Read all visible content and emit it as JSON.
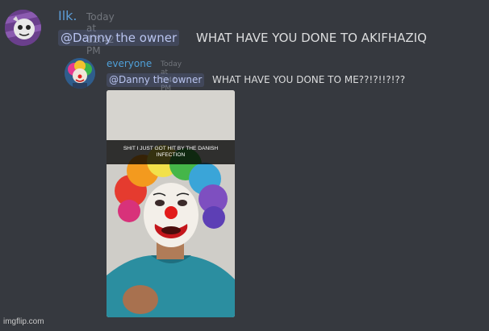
{
  "messages": [
    {
      "username": "Ilk.",
      "timestamp": "Today at 12:42 PM",
      "mention": "@Danny the owner",
      "text": "WHAT HAVE YOU DONE TO AKIFHAZIQ"
    },
    {
      "username": "everyone",
      "timestamp": "Today at 5:41 PM",
      "mention": "@Danny the owner",
      "text": "WHAT HAVE YOU DONE TO ME??!?!!?!??",
      "attachment_caption": "SHIT I JUST GOT HIT BY THE DANISH INFECTION"
    }
  ],
  "watermark": "imgflip.com",
  "colors": {
    "background": "#36393f",
    "username_blue": "#5b9bd5",
    "mention_bg": "#414675",
    "mention_text": "#b9c4ef",
    "timestamp": "#72767d",
    "message_text": "#dcddde"
  }
}
